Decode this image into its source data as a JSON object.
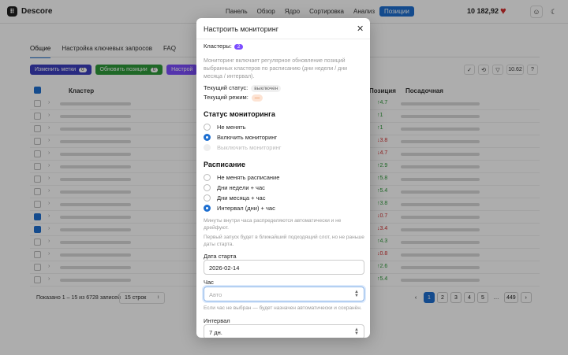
{
  "app": {
    "name": "Descore",
    "logo_glyph": "⠿"
  },
  "nav": [
    "Панель",
    "Обзор",
    "Ядро",
    "Сортировка",
    "Анализ",
    "Позиции"
  ],
  "nav_active": 5,
  "balance": "10 182,92",
  "heart_icon": "♥",
  "user_icon": "☺",
  "theme_icon": "☾",
  "tabs": [
    "Общие",
    "Настройка ключевых запросов",
    "FAQ"
  ],
  "actions": [
    {
      "label": "Изменить метки",
      "count": "0",
      "color": "#3b3fbf"
    },
    {
      "label": "Обновить позиции",
      "count": "0",
      "color": "#2e9a3a"
    },
    {
      "label": "Настрой",
      "count": "",
      "color": "#7c4dff"
    }
  ],
  "toolbar_right": [
    "✓",
    "⟲",
    "▽",
    "10.62",
    "?"
  ],
  "table": {
    "headers": {
      "cluster": "Кластер",
      "position": "Позиция",
      "landing": "Посадочная"
    },
    "rows": [
      {
        "checked": false,
        "delta": "↑4.7",
        "color": "#2e9a3a"
      },
      {
        "checked": false,
        "delta": "↑1",
        "color": "#2e9a3a"
      },
      {
        "checked": false,
        "delta": "↑1",
        "color": "#2e9a3a"
      },
      {
        "checked": false,
        "delta": "↓3.8",
        "color": "#d32f2f"
      },
      {
        "checked": false,
        "delta": "↓4.7",
        "color": "#d32f2f"
      },
      {
        "checked": false,
        "delta": "↑2.9",
        "color": "#2e9a3a"
      },
      {
        "checked": false,
        "delta": "↑5.8",
        "color": "#2e9a3a"
      },
      {
        "checked": false,
        "delta": "↑5.4",
        "color": "#2e9a3a"
      },
      {
        "checked": false,
        "delta": "↑3.8",
        "color": "#2e9a3a"
      },
      {
        "checked": true,
        "delta": "↓0.7",
        "color": "#d32f2f"
      },
      {
        "checked": true,
        "delta": "↓3.4",
        "color": "#d32f2f"
      },
      {
        "checked": false,
        "delta": "↑4.3",
        "color": "#2e9a3a"
      },
      {
        "checked": false,
        "delta": "↓0.8",
        "color": "#d32f2f"
      },
      {
        "checked": false,
        "delta": "↑2.6",
        "color": "#2e9a3a"
      },
      {
        "checked": false,
        "delta": "↑5.4",
        "color": "#2e9a3a"
      }
    ]
  },
  "pager": {
    "info": "Показано 1 – 15 из 6728 записей",
    "per_page": "15 строк",
    "pages": [
      "‹",
      "1",
      "2",
      "3",
      "4",
      "5",
      "…",
      "449",
      "›"
    ],
    "active": 1
  },
  "modal": {
    "title": "Настроить мониторинг",
    "close_icon": "✕",
    "clusters_label": "Кластеры:",
    "clusters_count": "2",
    "description": "Мониторинг включает регулярное обновление позиций выбранных кластеров по расписанию (дни недели / дни месяца / интервал).",
    "current_status_label": "Текущий статус:",
    "current_status_value": "выключен",
    "current_mode_label": "Текущий режим:",
    "current_mode_value": "—",
    "status_title": "Статус мониторинга",
    "status_options": [
      {
        "label": "Не менять",
        "selected": false,
        "disabled": false
      },
      {
        "label": "Включить мониторинг",
        "selected": true,
        "disabled": false
      },
      {
        "label": "Выключить мониторинг",
        "selected": false,
        "disabled": true
      }
    ],
    "schedule_title": "Расписание",
    "schedule_options": [
      {
        "label": "Не менять расписание",
        "selected": false
      },
      {
        "label": "Дни недели + час",
        "selected": false
      },
      {
        "label": "Дни месяца + час",
        "selected": false
      },
      {
        "label": "Интервал (дни) + час",
        "selected": true
      }
    ],
    "help_minutes": "Минуты внутри часа распределяются автоматически и не дрейфуют.",
    "help_first_run": "Первый запуск будет в ближайший подходящий слот, но не раньше даты старта.",
    "start_date_label": "Дата старта",
    "start_date_value": "2026-02-14",
    "hour_label": "Час",
    "hour_placeholder": "Авто",
    "hour_help": "Если час не выбран — будет назначен автоматически и сохранён.",
    "interval_label": "Интервал",
    "interval_value": "7 дн."
  }
}
